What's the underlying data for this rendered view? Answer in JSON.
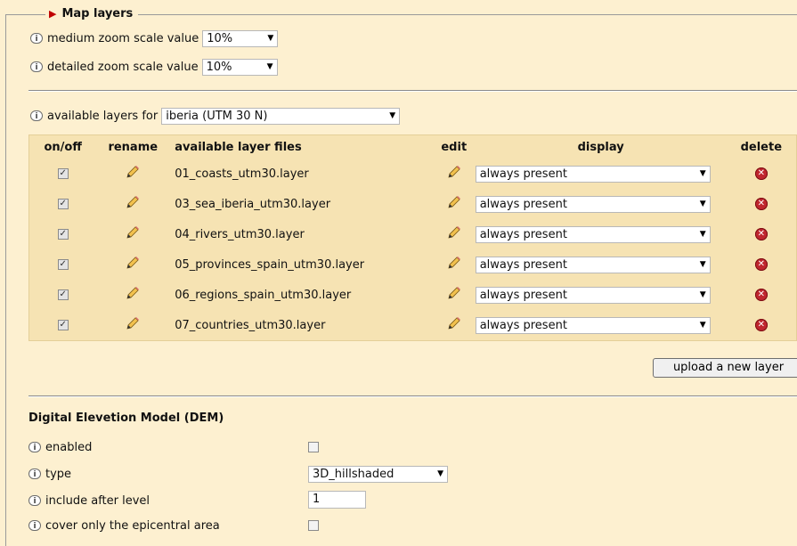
{
  "fieldset": {
    "title": "Map layers"
  },
  "zoom": {
    "medium_label": "medium zoom scale value",
    "medium_value": "10%",
    "detailed_label": "detailed zoom scale value",
    "detailed_value": "10%"
  },
  "layers": {
    "available_label": "available layers for",
    "available_value": "iberia (UTM 30 N)",
    "headers": {
      "onoff": "on/off",
      "rename": "rename",
      "files": "available layer files",
      "edit": "edit",
      "display": "display",
      "delete": "delete"
    },
    "rows": [
      {
        "file": "01_coasts_utm30.layer",
        "display": "always present",
        "checked": true
      },
      {
        "file": "03_sea_iberia_utm30.layer",
        "display": "always present",
        "checked": true
      },
      {
        "file": "04_rivers_utm30.layer",
        "display": "always present",
        "checked": true
      },
      {
        "file": "05_provinces_spain_utm30.layer",
        "display": "always present",
        "checked": true
      },
      {
        "file": "06_regions_spain_utm30.layer",
        "display": "always present",
        "checked": true
      },
      {
        "file": "07_countries_utm30.layer",
        "display": "always present",
        "checked": true
      }
    ],
    "upload_label": "upload a new layer"
  },
  "dem": {
    "title": "Digital Elevetion Model (DEM)",
    "enabled_label": "enabled",
    "enabled": false,
    "type_label": "type",
    "type_value": "3D_hillshaded",
    "level_label": "include after level",
    "level_value": "1",
    "epicentral_label": "cover only the epicentral area",
    "epicentral": false
  },
  "icons": {
    "info": "i",
    "check": "✓",
    "delete": "✕",
    "dropdown": "▼"
  },
  "colors": {
    "background": "#fdf0d0",
    "table": "#f6e3b3",
    "delete": "#c0262e",
    "legend_arrow": "#c00000"
  }
}
